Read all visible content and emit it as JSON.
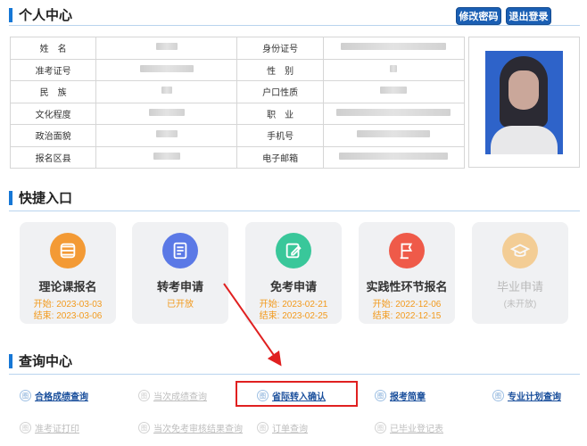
{
  "profile": {
    "title": "个人中心",
    "change_password": "修改密码",
    "logout": "退出登录",
    "rows": [
      {
        "l1": "姓　名",
        "w1": 24,
        "l2": "身份证号",
        "w2": 118
      },
      {
        "l1": "准考证号",
        "w1": 60,
        "l2": "性　别",
        "w2": 8
      },
      {
        "l1": "民　族",
        "w1": 12,
        "l2": "户口性质",
        "w2": 30
      },
      {
        "l1": "文化程度",
        "w1": 40,
        "l2": "职　业",
        "w2": 128
      },
      {
        "l1": "政治面貌",
        "w1": 24,
        "l2": "手机号",
        "w2": 82
      },
      {
        "l1": "报名区县",
        "w1": 30,
        "l2": "电子邮箱",
        "w2": 122
      }
    ]
  },
  "quick": {
    "title": "快捷入口",
    "cards": [
      {
        "name": "理论课报名",
        "line1": "开始: 2023-03-03",
        "line2": "结束: 2023-03-06",
        "color": "#f39a35",
        "icon": "layers-icon"
      },
      {
        "name": "转考申请",
        "line1": "已开放",
        "line2": "",
        "color": "#5b79e6",
        "icon": "document-icon"
      },
      {
        "name": "免考申请",
        "line1": "开始: 2023-02-21",
        "line2": "结束: 2023-02-25",
        "color": "#39c79a",
        "icon": "edit-icon"
      },
      {
        "name": "实践性环节报名",
        "line1": "开始: 2022-12-06",
        "line2": "结束: 2022-12-15",
        "color": "#ef5a49",
        "icon": "flag-icon"
      },
      {
        "name": "毕业申请",
        "line1": "(未开放)",
        "line2": "",
        "color": "#f6b04a",
        "icon": "graduation-cap-icon"
      }
    ]
  },
  "query": {
    "title": "查询中心",
    "icon_glyph": "图",
    "links": [
      {
        "text": "合格成绩查询",
        "enabled": true
      },
      {
        "text": "当次成绩查询",
        "enabled": false
      },
      {
        "text": "省际转入确认",
        "enabled": true
      },
      {
        "text": "报考简章",
        "enabled": true
      },
      {
        "text": "专业计划查询",
        "enabled": true
      },
      {
        "text": "准考证打印",
        "enabled": false
      },
      {
        "text": "当次免考审核结果查询",
        "enabled": false
      },
      {
        "text": "订单查询",
        "enabled": false
      },
      {
        "text": "已毕业登记表",
        "enabled": false
      }
    ]
  },
  "colors": {
    "accent": "#1677d6",
    "button": "#1a5fb4",
    "highlight": "#e02020",
    "date": "#f29a1d",
    "link": "#1a4f9c"
  }
}
